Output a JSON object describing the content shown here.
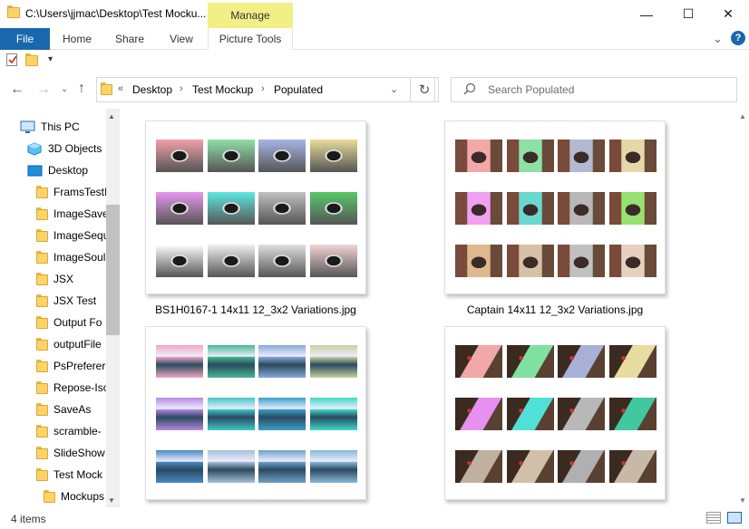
{
  "window": {
    "title": "C:\\Users\\jjmac\\Desktop\\Test Mocku...",
    "manage": "Manage",
    "controls": {
      "minimize": "—",
      "maximize": "☐",
      "close": "✕"
    }
  },
  "ribbon": {
    "file": "File",
    "tabs": [
      "Home",
      "Share",
      "View"
    ],
    "picture_tools": "Picture Tools",
    "help": "?",
    "collapse": "⌄"
  },
  "address": {
    "prefix": "«",
    "crumbs": [
      "Desktop",
      "Test Mockup",
      "Populated"
    ]
  },
  "search": {
    "placeholder": "Search Populated"
  },
  "sidebar": {
    "items": [
      {
        "label": "This PC",
        "icon": "pc-icon",
        "indent": 0
      },
      {
        "label": "3D Objects",
        "icon": "cube-icon",
        "indent": 1
      },
      {
        "label": "Desktop",
        "icon": "desktop-icon",
        "indent": 1
      },
      {
        "label": "FramsTestI",
        "icon": "folder-icon",
        "indent": 2
      },
      {
        "label": "ImageSave",
        "icon": "folder-icon",
        "indent": 2
      },
      {
        "label": "ImageSequ",
        "icon": "folder-icon",
        "indent": 2
      },
      {
        "label": "ImageSoul",
        "icon": "folder-icon",
        "indent": 2
      },
      {
        "label": "JSX",
        "icon": "folder-icon",
        "indent": 2
      },
      {
        "label": "JSX Test",
        "icon": "folder-icon",
        "indent": 2
      },
      {
        "label": "Output Fo",
        "icon": "folder-icon",
        "indent": 2
      },
      {
        "label": "outputFile",
        "icon": "folder-icon",
        "indent": 2
      },
      {
        "label": "PsPreferer",
        "icon": "folder-icon",
        "indent": 2
      },
      {
        "label": "Repose-Iso",
        "icon": "folder-icon",
        "indent": 2
      },
      {
        "label": "SaveAs",
        "icon": "folder-icon",
        "indent": 2
      },
      {
        "label": "scramble-",
        "icon": "folder-icon",
        "indent": 2
      },
      {
        "label": "SlideShow",
        "icon": "folder-icon",
        "indent": 2
      },
      {
        "label": "Test Mock",
        "icon": "folder-icon",
        "indent": 2
      },
      {
        "label": "Mockups",
        "icon": "folder-icon",
        "indent": 3
      }
    ]
  },
  "files": [
    {
      "name": "BS1H0167-1 14x11 12_3x2 Variations.jpg",
      "subject": "dog",
      "tints": [
        "#f2a0a8",
        "#8fe0a8",
        "#a8b4e8",
        "#e8dc98",
        "#e898f0",
        "#5ee8e0",
        "#c0c0c0",
        "#58c868",
        "#ffffff",
        "#f0f0f0",
        "#e0e0e0",
        "#f4d4d4"
      ]
    },
    {
      "name": "Captain 14x11 12_3x2 Variations.jpg",
      "subject": "captain",
      "tints": [
        "#f2a8a8",
        "#8ee0a4",
        "#b4b8d0",
        "#e4d8a8",
        "#f0a0f0",
        "#6ad8d0",
        "#b8b8b8",
        "#98e070",
        "#e0b890",
        "#d8c0a8",
        "#c0c0c0",
        "#e8d0c0"
      ]
    },
    {
      "name": "",
      "subject": "island",
      "tints": [
        "#f0a8c0",
        "#48b890",
        "#88a8d8",
        "#c8d0a0",
        "#b888e0",
        "#40c8c8",
        "#3aa0c8",
        "#40d8c8",
        "#4a88c0",
        "#a8c0d8",
        "#70a0c8",
        "#88b8d8"
      ]
    },
    {
      "name": "",
      "subject": "lighthouse",
      "tints": [
        "#f0a8a8",
        "#80e0a0",
        "#a8b0d8",
        "#e8dca0",
        "#e890f0",
        "#50e0d8",
        "#b8b8b8",
        "#40c8a0",
        "#c0b0a0",
        "#d0c0a8",
        "#b0b0b0",
        "#c8b8a8"
      ]
    }
  ],
  "status": {
    "count": "4 items"
  }
}
